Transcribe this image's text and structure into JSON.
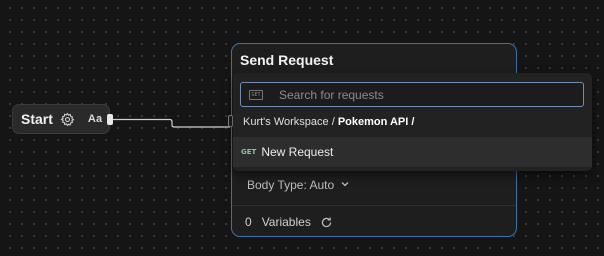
{
  "start_node": {
    "label": "Start",
    "badge": "Aa"
  },
  "request_node": {
    "title": "Send Request",
    "body_type_label": "Body Type: Auto",
    "variables_count": "0",
    "variables_label": "Variables"
  },
  "dropdown": {
    "search_placeholder": "Search for requests",
    "search_icon_text": "GET",
    "breadcrumb": {
      "workspace": "Kurt's Workspace /",
      "collection": "Pokemon API /"
    },
    "items": [
      {
        "method": "GET",
        "name": "New Request"
      }
    ]
  },
  "colors": {
    "canvas_bg": "#151515",
    "node_border_selected": "#3f6fa8",
    "method_get": "#7ccf8c"
  }
}
